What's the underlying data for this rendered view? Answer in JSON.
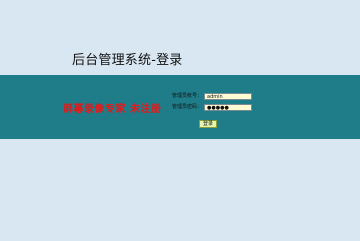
{
  "page": {
    "title": "后台管理系统-登录"
  },
  "watermark": {
    "text": "屏幕录像专家 未注册"
  },
  "login_form": {
    "username_label": "管理员帐号：",
    "username_value": "admin",
    "password_label": "管理员密码：",
    "password_value": "●●●●●",
    "submit_label": "登录"
  },
  "colors": {
    "background": "#d8e7f1",
    "band": "#1f7d8a",
    "field_background": "#fffcd4",
    "button_background": "#e8f7b0",
    "watermark": "#e01a1a"
  }
}
